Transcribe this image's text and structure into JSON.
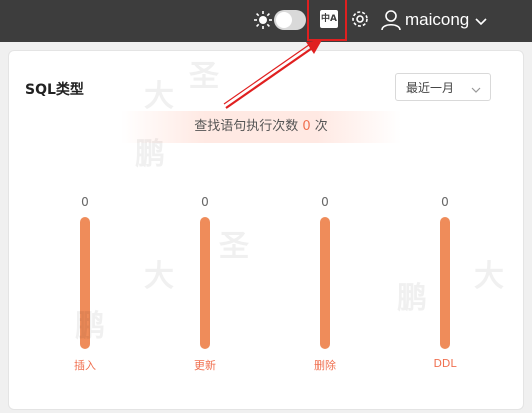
{
  "header": {
    "username": "maicong",
    "translate_icon_text": "中A"
  },
  "panel": {
    "title": "SQL类型",
    "range_select": "最近一月",
    "summary_prefix": "查找语句执行次数",
    "summary_count": "0",
    "summary_suffix": "次"
  },
  "chart_data": {
    "type": "bar",
    "categories": [
      "插入",
      "更新",
      "删除",
      "DDL"
    ],
    "values": [
      0,
      0,
      0,
      0
    ],
    "bar_color": "#ef8c5a"
  },
  "watermark": {
    "chars": [
      "鹏",
      "大",
      "圣"
    ]
  },
  "colors": {
    "topbar": "#3d3d3d",
    "accent": "#f07050",
    "annotation": "#e02020"
  }
}
